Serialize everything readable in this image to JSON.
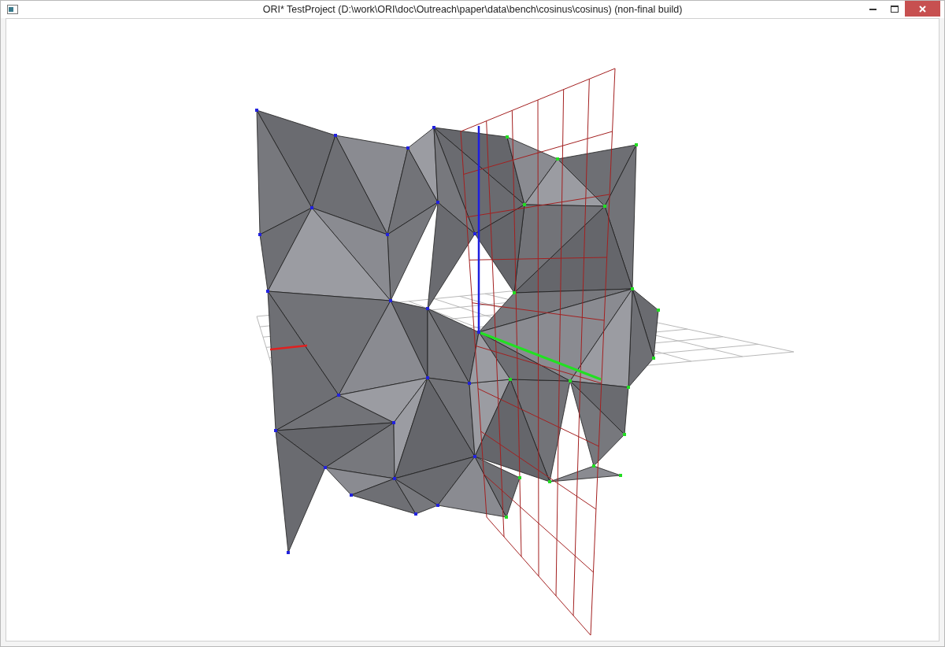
{
  "window": {
    "title": "ORI* TestProject (D:\\work\\ORI\\doc\\Outreach\\paper\\data\\bench\\cosinus\\cosinus) (non-final build)"
  }
}
